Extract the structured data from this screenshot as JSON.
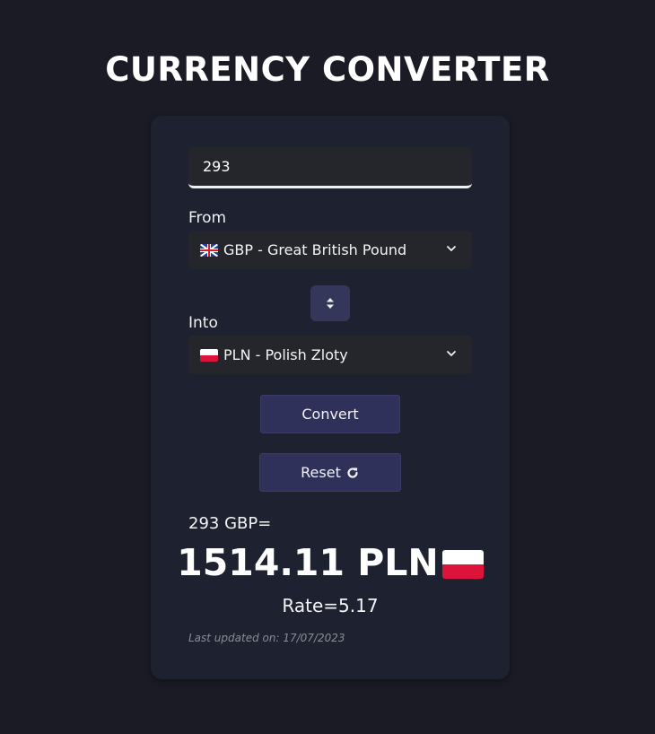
{
  "title": "CURRENCY CONVERTER",
  "amount": {
    "value": "293"
  },
  "from": {
    "label": "From",
    "selected": "GBP - Great British Pound",
    "flag_icon": "gb-flag-icon"
  },
  "into": {
    "label": "Into",
    "selected": "PLN - Polish Zloty",
    "flag_icon": "pl-flag-icon"
  },
  "buttons": {
    "convert": "Convert",
    "reset": "Reset"
  },
  "result": {
    "from_text": "293 GBP=",
    "amount_text": "1514.11 PLN",
    "rate_text": "Rate=5.17",
    "updated_text": "Last updated on: 17/07/2023"
  },
  "colors": {
    "background": "#1a1b24",
    "card": "#1e2230",
    "button": "#30315a",
    "input": "#25262b"
  }
}
